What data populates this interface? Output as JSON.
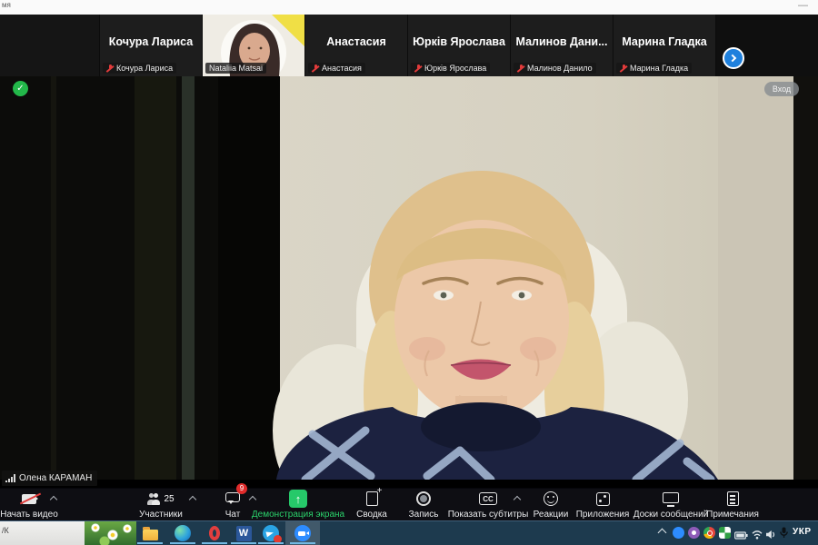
{
  "window": {
    "title_fragment": "мя",
    "minimize_glyph": "—"
  },
  "filmstrip": {
    "participants": [
      {
        "name": "Кочура Лариса",
        "tag": "Кочура Лариса",
        "muted": true,
        "video": false
      },
      {
        "name": "",
        "tag": "Nataliia Matsai",
        "muted": false,
        "video": true
      },
      {
        "name": "Анастасия",
        "tag": "Анастасия",
        "muted": true,
        "video": false
      },
      {
        "name": "Юрків Ярослава",
        "tag": "Юрків Ярослава",
        "muted": true,
        "video": false
      },
      {
        "name": "Малинов  Дани...",
        "tag": "Малинов Данило",
        "muted": true,
        "video": false
      },
      {
        "name": "Марина Гладка",
        "tag": "Марина Гладка",
        "muted": true,
        "video": false
      }
    ],
    "next_button_icon": "chevron-right-icon"
  },
  "main_video": {
    "encryption_icon": "shield-check-icon",
    "entry_badge": "Вход",
    "speaker_tag": "Олена КАРАМАН",
    "signal_icon": "audio-level-bars-icon"
  },
  "toolbar": {
    "cc_text": "CC",
    "items": [
      {
        "label": "Начать видео",
        "icon": "video-camera-off-icon",
        "caret": true
      },
      {
        "label": "Участники",
        "icon": "participants-icon",
        "count": "25",
        "caret": true
      },
      {
        "label": "Чат",
        "icon": "chat-bubble-icon",
        "badge": "9",
        "caret": true
      },
      {
        "label": "Демонстрация экрана",
        "icon": "screen-share-icon",
        "accent": true
      },
      {
        "label": "Сводка",
        "icon": "summary-doc-icon"
      },
      {
        "label": "Запись",
        "icon": "record-icon"
      },
      {
        "label": "Показать субтитры",
        "icon": "captions-cc-icon",
        "caret": true
      },
      {
        "label": "Реакции",
        "icon": "reactions-smiley-icon"
      },
      {
        "label": "Приложения",
        "icon": "apps-icon"
      },
      {
        "label": "Доски сообщений",
        "icon": "whiteboards-icon"
      },
      {
        "label": "Примечания",
        "icon": "notes-icon"
      }
    ]
  },
  "taskbar": {
    "peek_text": "/К",
    "word_glyph": "W",
    "apps": [
      "file-explorer-icon",
      "edge-icon",
      "opera-icon",
      "word-icon",
      "telegram-icon",
      "zoom-icon"
    ],
    "tray": [
      "tray-expand-icon",
      "zoom-tray-icon",
      "viber-icon",
      "red-app-icon",
      "green-app-icon",
      "battery-icon",
      "wifi-icon",
      "volume-icon",
      "microphone-icon"
    ],
    "language": "УКР"
  },
  "colors": {
    "accent_green": "#26c96a",
    "badge_red": "#e02b2b",
    "taskbar_teal": "#1d3a4e",
    "zoom_blue": "#2d8cff",
    "arrow_blue": "#1e80dd"
  }
}
